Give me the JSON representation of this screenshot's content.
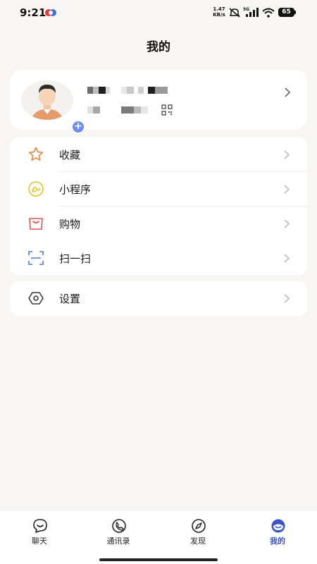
{
  "status_bar": {
    "time": "9:21",
    "net_speed_value": "1.47",
    "net_speed_unit": "KB/s",
    "network_type": "5G",
    "battery": "65"
  },
  "header": {
    "title": "我的"
  },
  "profile": {
    "avatar_icon": "user-avatar",
    "add_icon": "plus-icon",
    "qr_icon": "qr-code-icon"
  },
  "menu": {
    "items": [
      {
        "label": "收藏",
        "icon": "star-icon",
        "color": "#e7853b"
      },
      {
        "label": "小程序",
        "icon": "mini-program-icon",
        "color": "#e6c228"
      },
      {
        "label": "购物",
        "icon": "shopping-bag-icon",
        "color": "#e65050"
      },
      {
        "label": "扫一扫",
        "icon": "scan-icon",
        "color": "#4b79d6"
      }
    ]
  },
  "settings": {
    "label": "设置",
    "icon": "settings-hexagon-icon"
  },
  "bottom_nav": {
    "items": [
      {
        "label": "聊天",
        "icon": "chat-icon",
        "active": false
      },
      {
        "label": "通讯录",
        "icon": "contacts-icon",
        "active": false
      },
      {
        "label": "发现",
        "icon": "compass-icon",
        "active": false
      },
      {
        "label": "我的",
        "icon": "profile-icon",
        "active": true
      }
    ],
    "active_color": "#3b55c9"
  }
}
